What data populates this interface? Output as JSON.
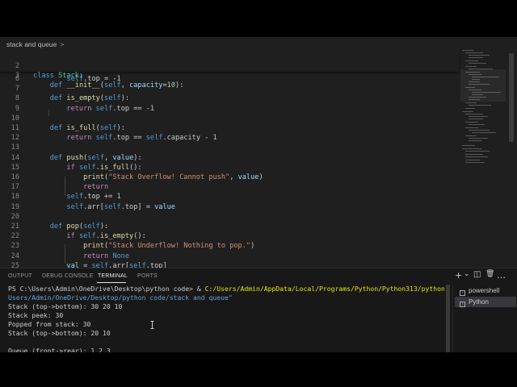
{
  "editor": {
    "breadcrumb": {
      "folder": "stack and queue",
      "separator": ">"
    },
    "sticky": [
      {
        "num": "2",
        "html": "<span class=\"kw\">class</span> <span class=\"cls\">Stack</span>:"
      },
      {
        "num": "3",
        "html": "    <span class=\"kw\">def</span> <span class=\"fn\">__init__</span>(<span class=\"self\">self</span>, <span class=\"par\">capacity</span>=<span class=\"num\">10</span>):"
      }
    ],
    "lines": [
      {
        "num": "6",
        "html": "        <span class=\"self\">self</span>.top = -<span class=\"num\">1</span>"
      },
      {
        "num": "7",
        "html": ""
      },
      {
        "num": "8",
        "html": "    <span class=\"kw\">def</span> <span class=\"fn\">is_empty</span>(<span class=\"self\">self</span>):"
      },
      {
        "num": "9",
        "html": "        <span class=\"ctl\">return</span> <span class=\"self\">self</span>.top == -<span class=\"num\">1</span>"
      },
      {
        "num": "10",
        "html": ""
      },
      {
        "num": "11",
        "html": "    <span class=\"kw\">def</span> <span class=\"fn\">is_full</span>(<span class=\"self\">self</span>):"
      },
      {
        "num": "12",
        "html": "        <span class=\"ctl\">return</span> <span class=\"self\">self</span>.top == <span class=\"self\">self</span>.capacity - <span class=\"num\">1</span>"
      },
      {
        "num": "13",
        "html": ""
      },
      {
        "num": "14",
        "html": "    <span class=\"kw\">def</span> <span class=\"fn\">push</span>(<span class=\"self\">self</span>, <span class=\"par\">value</span>):"
      },
      {
        "num": "15",
        "html": "        <span class=\"ctl\">if</span> <span class=\"self\">self</span>.<span class=\"fn\">is_full</span>():"
      },
      {
        "num": "16",
        "html": "            <span class=\"fn\">print</span>(<span class=\"str\">\"Stack Overflow! Cannot push\"</span>, <span class=\"par\">value</span>)"
      },
      {
        "num": "17",
        "html": "            <span class=\"ctl\">return</span>"
      },
      {
        "num": "18",
        "html": "        <span class=\"self\">self</span>.top += <span class=\"num\">1</span>"
      },
      {
        "num": "19",
        "html": "        <span class=\"self\">self</span>.arr[<span class=\"self\">self</span>.top] = <span class=\"par\">value</span>"
      },
      {
        "num": "20",
        "html": ""
      },
      {
        "num": "21",
        "html": "    <span class=\"kw\">def</span> <span class=\"fn\">pop</span>(<span class=\"self\">self</span>):"
      },
      {
        "num": "22",
        "html": "        <span class=\"ctl\">if</span> <span class=\"self\">self</span>.<span class=\"fn\">is_empty</span>():"
      },
      {
        "num": "23",
        "html": "            <span class=\"fn\">print</span>(<span class=\"str\">\"Stack Underflow! Nothing to pop.\"</span>)"
      },
      {
        "num": "24",
        "html": "            <span class=\"ctl\">return</span> <span class=\"kw\">None</span>"
      },
      {
        "num": "25",
        "html": "        <span class=\"par\">val</span> = <span class=\"self\">self</span>.arr[<span class=\"self\">self</span>.top]"
      }
    ]
  },
  "panel": {
    "tabs": {
      "output": "OUTPUT",
      "debug_console": "DEBUG CONSOLE",
      "terminal": "TERMINAL",
      "ports": "PORTS"
    },
    "actions": {
      "add": "+",
      "dropdown": "⌄",
      "split": "◫",
      "trash": "🗑",
      "more": "…"
    },
    "terminal_lines": [
      {
        "html": "<span class=\"prompt-path\">PS C:\\Users\\Admin\\OneDrive\\Desktop\\python code&gt; &amp; </span><span class=\"cmd-exe\">C:/Users/Admin/AppData/Local/Programs/Python/Python313/python.exe</span> <span class=\"cmd-arg\">\"c:/</span>"
      },
      {
        "html": "<span class=\"cmd-arg\">Users/Admin/OneDrive/Desktop/python code/stack and queue\"</span>"
      },
      {
        "html": "Stack (top-&gt;bottom): 30 20 10"
      },
      {
        "html": "Stack peek: 30"
      },
      {
        "html": "Popped from stack: 30"
      },
      {
        "html": "Stack (top-&gt;bottom): 20 10"
      },
      {
        "html": ""
      },
      {
        "html": "Queue (front-&gt;rear): 1 2 3"
      }
    ],
    "terminal_list": [
      "powershell",
      "Python"
    ],
    "selected_terminal": "Python"
  },
  "colors": {
    "editor_bg": "#1f1f1f",
    "panel_bg": "#181818",
    "keyword": "#569cd6",
    "control": "#c586c0",
    "function": "#dcdcaa",
    "class": "#4ec9b0",
    "string": "#ce9178",
    "number": "#b5cea8",
    "exe_path": "#e5e510"
  }
}
